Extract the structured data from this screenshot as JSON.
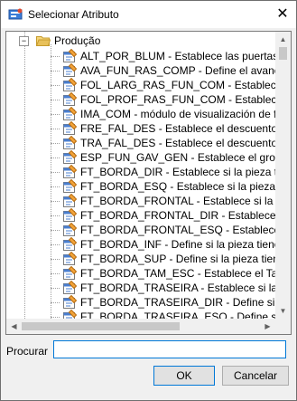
{
  "window": {
    "title": "Selecionar Atributo",
    "close_glyph": "✕",
    "icon": "app-icon"
  },
  "tree": {
    "folder": {
      "label": "Produção",
      "expander": "−",
      "icon": "folder-open-icon"
    },
    "items": [
      {
        "label": "ALT_POR_BLUM - Establece las puertas al"
      },
      {
        "label": "AVA_FUN_RAS_COMP - Define el avance d"
      },
      {
        "label": "FOL_LARG_RAS_FUN_COM - Establece h"
      },
      {
        "label": "FOL_PROF_RAS_FUN_COM - Establece"
      },
      {
        "label": "IMA_COM - módulo de visualización de forr"
      },
      {
        "label": "FRE_FAL_DES - Establece el descuento de"
      },
      {
        "label": "TRA_FAL_DES - Establece el descuento de"
      },
      {
        "label": "ESP_FUN_GAV_GEN - Establece el grosor"
      },
      {
        "label": "FT_BORDA_DIR - Establece si la pieza tiene"
      },
      {
        "label": "FT_BORDA_ESQ - Establece si la pieza tien"
      },
      {
        "label": "FT_BORDA_FRONTAL - Establece si la pie"
      },
      {
        "label": "FT_BORDA_FRONTAL_DIR - Establece si"
      },
      {
        "label": "FT_BORDA_FRONTAL_ESQ - Establece s"
      },
      {
        "label": "FT_BORDA_INF - Define si la pieza tiene b"
      },
      {
        "label": "FT_BORDA_SUP - Define si la pieza tiene t"
      },
      {
        "label": "FT_BORDA_TAM_ESC - Establece el Tapa"
      },
      {
        "label": "FT_BORDA_TRASEIRA - Establece si la pi"
      },
      {
        "label": "FT_BORDA_TRASEIRA_DIR - Define si la p"
      },
      {
        "label": "FT_BORDA_TRASEIRA_ESQ - Define si la p"
      }
    ],
    "item_icon": "attribute-icon",
    "scroll_up": "▲",
    "scroll_down": "▼",
    "scroll_left": "◀",
    "scroll_right": "▶"
  },
  "search": {
    "label": "Procurar",
    "value": ""
  },
  "buttons": {
    "ok": "OK",
    "cancel": "Cancelar"
  },
  "colors": {
    "accent": "#0078d7",
    "folder": "#e8c15a",
    "attribute_icon": "#f2a33a"
  }
}
